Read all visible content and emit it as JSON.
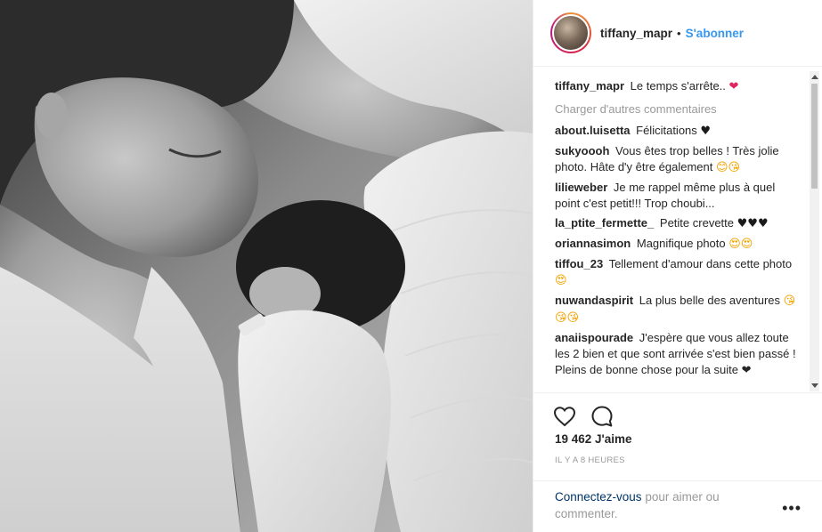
{
  "header": {
    "username": "tiffany_mapr",
    "separator": "•",
    "follow_label": "S'abonner",
    "avatar_icon": "profile-avatar"
  },
  "caption": {
    "username": "tiffany_mapr",
    "text": "Le temps s'arrête..",
    "emoji": "❤"
  },
  "load_more_label": "Charger d'autres commentaires",
  "comments": [
    {
      "username": "about.luisetta",
      "text": "Félicitations",
      "emoji": "♥"
    },
    {
      "username": "sukyoooh",
      "text": "Vous êtes trop belles ! Très jolie photo. Hâte d'y être également",
      "emoji": "😊😘"
    },
    {
      "username": "lilieweber",
      "text": "Je me rappel même plus à quel point c'est petit!!! Trop choubi...",
      "emoji": ""
    },
    {
      "username": "la_ptite_fermette_",
      "text": "Petite crevette",
      "emoji": "♥♥♥"
    },
    {
      "username": "oriannasimon",
      "text": "Magnifique photo",
      "emoji": "😍😍"
    },
    {
      "username": "tiffou_23",
      "text": "Tellement d'amour dans cette photo",
      "emoji": "😍"
    },
    {
      "username": "nuwandaspirit",
      "text": "La plus belle des aventures",
      "emoji": "😘😘😘"
    },
    {
      "username": "anaiispourade",
      "text": "J'espère que vous allez toute les 2 bien et que sont arrivée s'est bien passé ! Pleins de bonne chose pour la suite ❤",
      "emoji": ""
    }
  ],
  "actions": {
    "like_icon": "heart-outline-icon",
    "comment_icon": "comment-bubble-icon"
  },
  "likes": "19 462 J'aime",
  "timestamp": "IL Y A 8 HEURES",
  "footer": {
    "login_link": "Connectez-vous",
    "login_text": " pour aimer ou commenter.",
    "more_label": "•••"
  },
  "colors": {
    "link_blue": "#3897f0",
    "footer_link": "#003569",
    "muted": "#999999",
    "text": "#262626",
    "border": "#efefef"
  }
}
